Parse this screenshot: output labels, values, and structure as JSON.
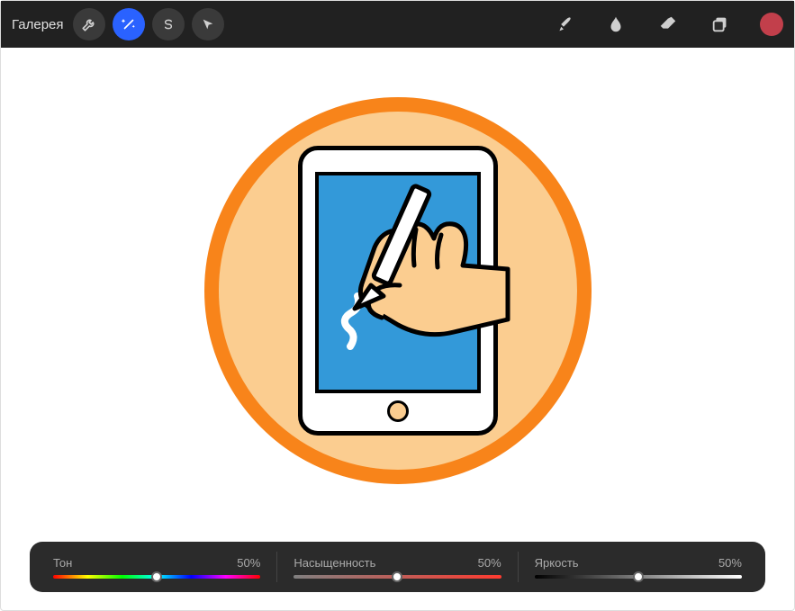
{
  "toolbar": {
    "gallery_label": "Галерея"
  },
  "sliders": {
    "hue": {
      "label": "Тон",
      "value": "50%"
    },
    "saturation": {
      "label": "Насыщенность",
      "value": "50%"
    },
    "brightness": {
      "label": "Яркость",
      "value": "50%"
    }
  },
  "colors": {
    "current": "#c23f4b"
  }
}
